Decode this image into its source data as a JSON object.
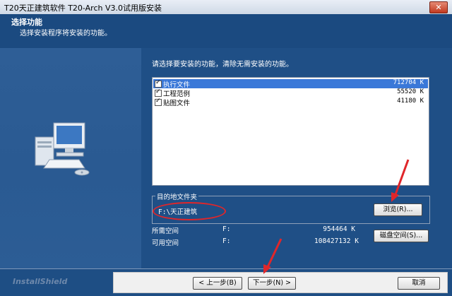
{
  "window": {
    "title": "T20天正建筑软件 T20-Arch V3.0试用版安装",
    "close_label": "✕"
  },
  "banner": {
    "title": "选择功能",
    "subtitle": "选择安装程序将安装的功能。"
  },
  "instruction": "请选择要安装的功能，清除无需安装的功能。",
  "features": [
    {
      "name": "执行文件",
      "size": "712704 K",
      "checked": true,
      "selected": true
    },
    {
      "name": "工程范例",
      "size": "55520 K",
      "checked": true,
      "selected": false
    },
    {
      "name": "贴图文件",
      "size": "41180 K",
      "checked": true,
      "selected": false
    }
  ],
  "destination": {
    "label": "目的地文件夹",
    "path": "F:\\天正建筑",
    "browse_label": "浏览(R)..."
  },
  "space": {
    "required_label": "所需空间",
    "required_drive": "F:",
    "required_amount": "954464 K",
    "available_label": "可用空间",
    "available_drive": "F:",
    "available_amount": "108427132 K"
  },
  "disk_space_label": "磁盘空间(S)...",
  "footer": {
    "brand": "InstallShield",
    "back_label": "< 上一步(B)",
    "next_label": "下一步(N) >",
    "cancel_label": "取消"
  },
  "colors": {
    "annotation": "#e0262a",
    "selection": "#3a78d8",
    "background": "#1f4f86"
  }
}
